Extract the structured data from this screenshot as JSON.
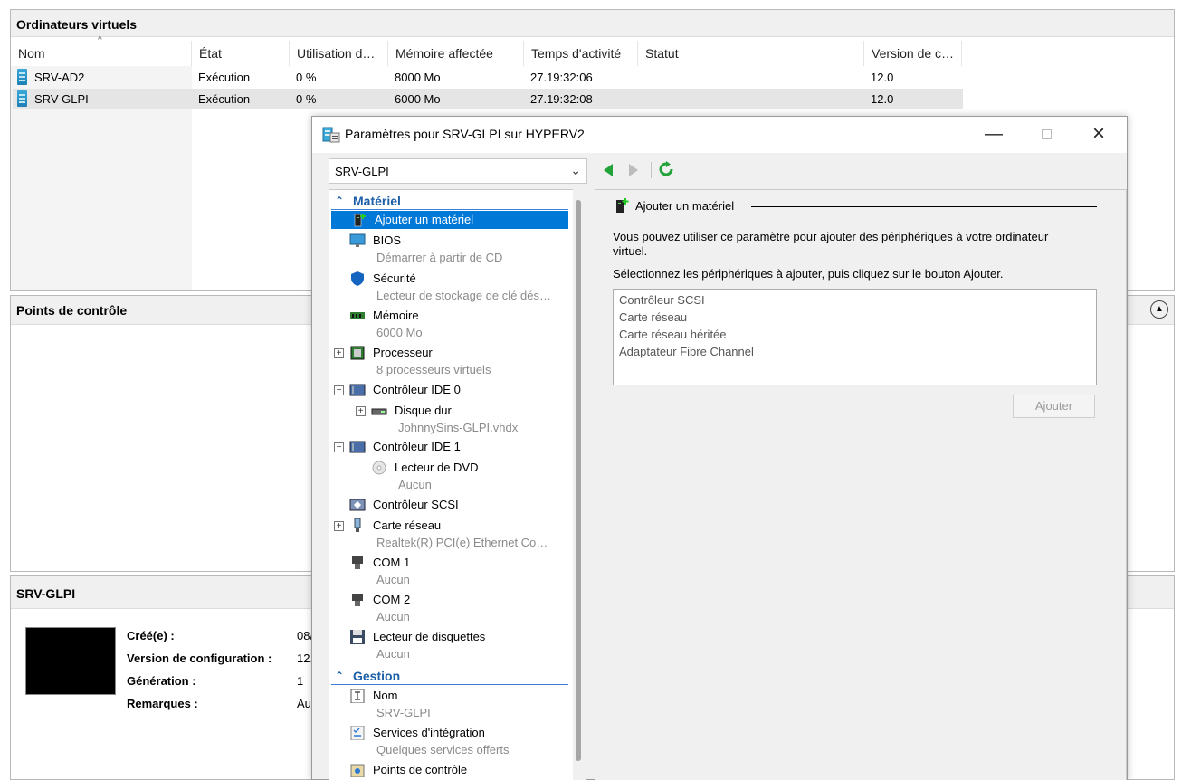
{
  "vm_pane": {
    "title": "Ordinateurs virtuels",
    "columns": [
      "Nom",
      "État",
      "Utilisation d…",
      "Mémoire affectée",
      "Temps d'activité",
      "Statut",
      "Version de c…"
    ],
    "rows": [
      {
        "name": "SRV-AD2",
        "state": "Exécution",
        "cpu": "0 %",
        "memory": "8000 Mo",
        "uptime": "27.19:32:06",
        "status": "",
        "version": "12.0"
      },
      {
        "name": "SRV-GLPI",
        "state": "Exécution",
        "cpu": "0 %",
        "memory": "6000 Mo",
        "uptime": "27.19:32:08",
        "status": "",
        "version": "12.0"
      }
    ]
  },
  "checkpoints_pane": {
    "title": "Points de contrôle"
  },
  "details_pane": {
    "title": "SRV-GLPI",
    "labels": [
      "Créé(e) :",
      "Version de configuration :",
      "Génération :",
      "Remarques :"
    ],
    "values": [
      "08/",
      "12.",
      "1",
      "Au"
    ]
  },
  "dialog": {
    "title": "Paramètres pour SRV-GLPI sur HYPERV2",
    "vm_selected": "SRV-GLPI",
    "sections": {
      "hardware": "Matériel",
      "management": "Gestion"
    },
    "hardware_items": [
      {
        "label": "Ajouter un matériel",
        "sub": ""
      },
      {
        "label": "BIOS",
        "sub": "Démarrer à partir de CD"
      },
      {
        "label": "Sécurité",
        "sub": "Lecteur de stockage de clé dés…"
      },
      {
        "label": "Mémoire",
        "sub": "6000 Mo"
      },
      {
        "label": "Processeur",
        "sub": "8 processeurs virtuels"
      },
      {
        "label": "Contrôleur IDE 0",
        "sub": ""
      },
      {
        "label": "Disque dur",
        "sub": "JohnnySins-GLPI.vhdx"
      },
      {
        "label": "Contrôleur IDE 1",
        "sub": ""
      },
      {
        "label": "Lecteur de DVD",
        "sub": "Aucun"
      },
      {
        "label": "Contrôleur SCSI",
        "sub": ""
      },
      {
        "label": "Carte réseau",
        "sub": "Realtek(R) PCI(e) Ethernet Co…"
      },
      {
        "label": "COM 1",
        "sub": "Aucun"
      },
      {
        "label": "COM 2",
        "sub": "Aucun"
      },
      {
        "label": "Lecteur de disquettes",
        "sub": "Aucun"
      }
    ],
    "management_items": [
      {
        "label": "Nom",
        "sub": "SRV-GLPI"
      },
      {
        "label": "Services d'intégration",
        "sub": "Quelques services offerts"
      },
      {
        "label": "Points de contrôle",
        "sub": ""
      }
    ],
    "panel": {
      "heading": "Ajouter un matériel",
      "description": "Vous pouvez utiliser ce paramètre pour ajouter des périphériques à votre ordinateur virtuel.",
      "instruction": "Sélectionnez les périphériques à ajouter, puis cliquez sur le bouton Ajouter.",
      "devices": [
        "Contrôleur SCSI",
        "Carte réseau",
        "Carte réseau héritée",
        "Adaptateur Fibre Channel"
      ],
      "add_button": "Ajouter"
    }
  },
  "colors": {
    "selection": "#0078d7",
    "section_blue": "#1c5fa8",
    "nav_green": "#22a33a"
  }
}
